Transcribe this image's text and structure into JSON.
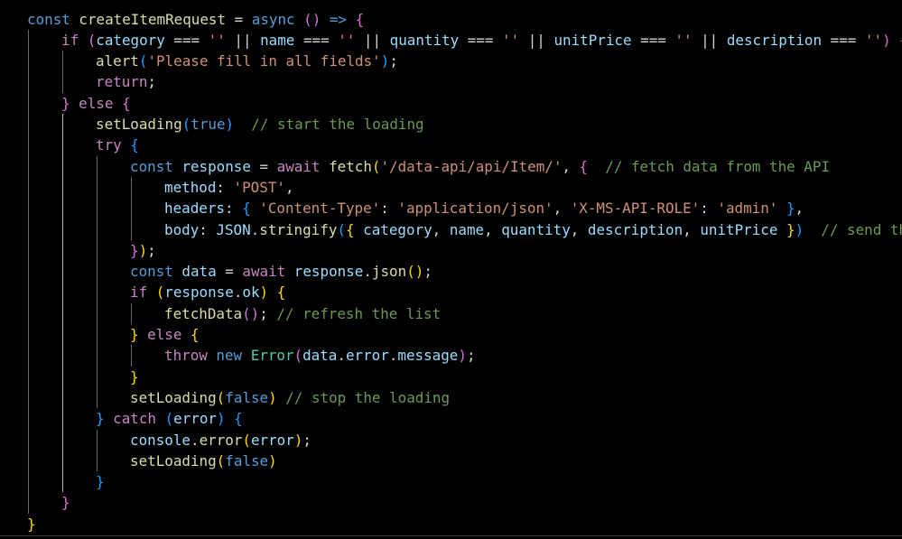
{
  "colors": {
    "background": "#000000",
    "default": "#d4d4d4",
    "keyword": "#569cd6",
    "control": "#c586c0",
    "function": "#dcdcaa",
    "variable": "#9cdcfe",
    "string": "#ce9178",
    "comment": "#6a9955",
    "class": "#4ec9b0",
    "bracket_gold": "#ffd700",
    "bracket_purple": "#da70d6",
    "bracket_blue": "#179fff"
  },
  "code": {
    "lines": [
      {
        "indent": 0,
        "tokens": [
          [
            "keyword",
            "const "
          ],
          [
            "function",
            "createItemRequest"
          ],
          [
            "default",
            " = "
          ],
          [
            "keyword",
            "async "
          ],
          [
            "bracket_purple",
            "()"
          ],
          [
            "keyword",
            " => "
          ],
          [
            "bracket_purple",
            "{"
          ]
        ]
      },
      {
        "indent": 1,
        "tokens": [
          [
            "control",
            "if "
          ],
          [
            "bracket_purple",
            "("
          ],
          [
            "variable",
            "category"
          ],
          [
            "default",
            " === "
          ],
          [
            "string",
            "''"
          ],
          [
            "default",
            " || "
          ],
          [
            "variable",
            "name"
          ],
          [
            "default",
            " === "
          ],
          [
            "string",
            "''"
          ],
          [
            "default",
            " || "
          ],
          [
            "variable",
            "quantity"
          ],
          [
            "default",
            " === "
          ],
          [
            "string",
            "''"
          ],
          [
            "default",
            " || "
          ],
          [
            "variable",
            "unitPrice"
          ],
          [
            "default",
            " === "
          ],
          [
            "string",
            "''"
          ],
          [
            "default",
            " || "
          ],
          [
            "variable",
            "description"
          ],
          [
            "default",
            " === "
          ],
          [
            "string",
            "''"
          ],
          [
            "bracket_purple",
            ")"
          ],
          [
            "default",
            " "
          ],
          [
            "bracket_purple",
            "{"
          ]
        ]
      },
      {
        "indent": 2,
        "tokens": [
          [
            "function",
            "alert"
          ],
          [
            "bracket_blue",
            "("
          ],
          [
            "string",
            "'Please fill in all fields'"
          ],
          [
            "bracket_blue",
            ")"
          ],
          [
            "default",
            ";"
          ]
        ]
      },
      {
        "indent": 2,
        "tokens": [
          [
            "control",
            "return"
          ],
          [
            "default",
            ";"
          ]
        ]
      },
      {
        "indent": 1,
        "tokens": [
          [
            "bracket_purple",
            "}"
          ],
          [
            "control",
            " else "
          ],
          [
            "bracket_purple",
            "{"
          ]
        ]
      },
      {
        "indent": 2,
        "tokens": [
          [
            "function",
            "setLoading"
          ],
          [
            "bracket_blue",
            "("
          ],
          [
            "keyword",
            "true"
          ],
          [
            "bracket_blue",
            ")"
          ],
          [
            "default",
            "  "
          ],
          [
            "comment",
            "// start the loading"
          ]
        ]
      },
      {
        "indent": 2,
        "tokens": [
          [
            "control",
            "try "
          ],
          [
            "bracket_blue",
            "{"
          ]
        ]
      },
      {
        "indent": 3,
        "tokens": [
          [
            "keyword",
            "const "
          ],
          [
            "variable",
            "response"
          ],
          [
            "default",
            " = "
          ],
          [
            "control",
            "await "
          ],
          [
            "function",
            "fetch"
          ],
          [
            "bracket_gold",
            "("
          ],
          [
            "string",
            "'/data-api/api/Item/'"
          ],
          [
            "default",
            ", "
          ],
          [
            "bracket_purple",
            "{"
          ],
          [
            "default",
            "  "
          ],
          [
            "comment",
            "// fetch data from the API"
          ]
        ]
      },
      {
        "indent": 4,
        "tokens": [
          [
            "variable",
            "method"
          ],
          [
            "default",
            ": "
          ],
          [
            "string",
            "'POST'"
          ],
          [
            "default",
            ","
          ]
        ]
      },
      {
        "indent": 4,
        "tokens": [
          [
            "variable",
            "headers"
          ],
          [
            "default",
            ": "
          ],
          [
            "bracket_blue",
            "{"
          ],
          [
            "default",
            " "
          ],
          [
            "string",
            "'Content-Type'"
          ],
          [
            "default",
            ": "
          ],
          [
            "string",
            "'application/json'"
          ],
          [
            "default",
            ", "
          ],
          [
            "string",
            "'X-MS-API-ROLE'"
          ],
          [
            "default",
            ": "
          ],
          [
            "string",
            "'admin'"
          ],
          [
            "default",
            " "
          ],
          [
            "bracket_blue",
            "}"
          ],
          [
            "default",
            ","
          ]
        ]
      },
      {
        "indent": 4,
        "tokens": [
          [
            "variable",
            "body"
          ],
          [
            "default",
            ": "
          ],
          [
            "variable",
            "JSON"
          ],
          [
            "default",
            "."
          ],
          [
            "function",
            "stringify"
          ],
          [
            "bracket_blue",
            "("
          ],
          [
            "bracket_gold",
            "{"
          ],
          [
            "default",
            " "
          ],
          [
            "variable",
            "category"
          ],
          [
            "default",
            ", "
          ],
          [
            "variable",
            "name"
          ],
          [
            "default",
            ", "
          ],
          [
            "variable",
            "quantity"
          ],
          [
            "default",
            ", "
          ],
          [
            "variable",
            "description"
          ],
          [
            "default",
            ", "
          ],
          [
            "variable",
            "unitPrice"
          ],
          [
            "default",
            " "
          ],
          [
            "bracket_gold",
            "}"
          ],
          [
            "bracket_blue",
            ")"
          ],
          [
            "default",
            "  "
          ],
          [
            "comment",
            "// send the"
          ]
        ]
      },
      {
        "indent": 3,
        "tokens": [
          [
            "bracket_purple",
            "}"
          ],
          [
            "bracket_gold",
            ")"
          ],
          [
            "default",
            ";"
          ]
        ]
      },
      {
        "indent": 3,
        "tokens": [
          [
            "keyword",
            "const "
          ],
          [
            "variable",
            "data"
          ],
          [
            "default",
            " = "
          ],
          [
            "control",
            "await "
          ],
          [
            "variable",
            "response"
          ],
          [
            "default",
            "."
          ],
          [
            "function",
            "json"
          ],
          [
            "bracket_gold",
            "()"
          ],
          [
            "default",
            ";"
          ]
        ]
      },
      {
        "indent": 3,
        "tokens": [
          [
            "control",
            "if "
          ],
          [
            "bracket_gold",
            "("
          ],
          [
            "variable",
            "response"
          ],
          [
            "default",
            "."
          ],
          [
            "variable",
            "ok"
          ],
          [
            "bracket_gold",
            ")"
          ],
          [
            "default",
            " "
          ],
          [
            "bracket_gold",
            "{"
          ]
        ]
      },
      {
        "indent": 4,
        "tokens": [
          [
            "function",
            "fetchData"
          ],
          [
            "bracket_purple",
            "()"
          ],
          [
            "default",
            "; "
          ],
          [
            "comment",
            "// refresh the list"
          ]
        ]
      },
      {
        "indent": 3,
        "tokens": [
          [
            "bracket_gold",
            "}"
          ],
          [
            "control",
            " else "
          ],
          [
            "bracket_gold",
            "{"
          ]
        ]
      },
      {
        "indent": 4,
        "tokens": [
          [
            "control",
            "throw "
          ],
          [
            "keyword",
            "new "
          ],
          [
            "class",
            "Error"
          ],
          [
            "bracket_purple",
            "("
          ],
          [
            "variable",
            "data"
          ],
          [
            "default",
            "."
          ],
          [
            "variable",
            "error"
          ],
          [
            "default",
            "."
          ],
          [
            "variable",
            "message"
          ],
          [
            "bracket_purple",
            ")"
          ],
          [
            "default",
            ";"
          ]
        ]
      },
      {
        "indent": 3,
        "tokens": [
          [
            "bracket_gold",
            "}"
          ]
        ]
      },
      {
        "indent": 3,
        "tokens": [
          [
            "function",
            "setLoading"
          ],
          [
            "bracket_gold",
            "("
          ],
          [
            "keyword",
            "false"
          ],
          [
            "bracket_gold",
            ")"
          ],
          [
            "default",
            " "
          ],
          [
            "comment",
            "// stop the loading"
          ]
        ]
      },
      {
        "indent": 2,
        "tokens": [
          [
            "bracket_blue",
            "}"
          ],
          [
            "control",
            " catch "
          ],
          [
            "bracket_blue",
            "("
          ],
          [
            "variable",
            "error"
          ],
          [
            "bracket_blue",
            ")"
          ],
          [
            "default",
            " "
          ],
          [
            "bracket_blue",
            "{"
          ]
        ]
      },
      {
        "indent": 3,
        "tokens": [
          [
            "variable",
            "console"
          ],
          [
            "default",
            "."
          ],
          [
            "function",
            "error"
          ],
          [
            "bracket_gold",
            "("
          ],
          [
            "variable",
            "error"
          ],
          [
            "bracket_gold",
            ")"
          ],
          [
            "default",
            ";"
          ]
        ]
      },
      {
        "indent": 3,
        "tokens": [
          [
            "function",
            "setLoading"
          ],
          [
            "bracket_gold",
            "("
          ],
          [
            "keyword",
            "false"
          ],
          [
            "bracket_gold",
            ")"
          ]
        ]
      },
      {
        "indent": 2,
        "tokens": [
          [
            "bracket_blue",
            "}"
          ]
        ]
      },
      {
        "indent": 1,
        "tokens": [
          [
            "bracket_purple",
            "}"
          ]
        ]
      },
      {
        "indent": 0,
        "tokens": [
          [
            "bracket_gold",
            "}"
          ]
        ]
      }
    ]
  }
}
